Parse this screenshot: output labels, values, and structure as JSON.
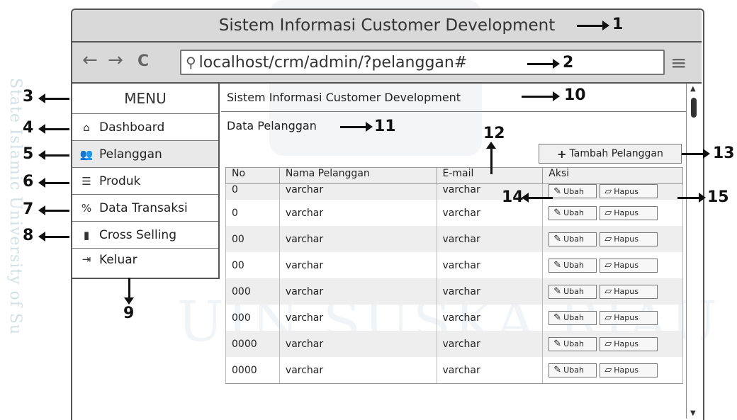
{
  "watermark": {
    "side": "State Islamic University of Su",
    "big": "UIN SUSKA RIAU"
  },
  "window": {
    "title": "Sistem Informasi Customer Development"
  },
  "browser": {
    "back": "←",
    "forward": "→",
    "reload": "C",
    "url": "localhost/crm/admin/?pelanggan#",
    "menu_icon": "≡"
  },
  "sidebar": {
    "title": "MENU",
    "items": [
      {
        "label": "Dashboard",
        "icon": "home-icon",
        "glyph": "⌂"
      },
      {
        "label": "Pelanggan",
        "icon": "users-icon",
        "glyph": "👥"
      },
      {
        "label": "Produk",
        "icon": "list-icon",
        "glyph": "☰"
      },
      {
        "label": "Data Transaksi",
        "icon": "percent-icon",
        "glyph": "%"
      },
      {
        "label": "Cross Selling",
        "icon": "file-icon",
        "glyph": "▮"
      },
      {
        "label": "Keluar",
        "icon": "logout-icon",
        "glyph": "⇥"
      }
    ]
  },
  "content": {
    "header": "Sistem Informasi Customer Development",
    "section_title": "Data Pelanggan",
    "add_button": "Tambah Pelanggan",
    "table": {
      "columns": [
        "No",
        "Nama Pelanggan",
        "E-mail",
        "Aksi"
      ],
      "rows": [
        {
          "no": "0",
          "nama": "varchar",
          "email": "varchar"
        },
        {
          "no": "0",
          "nama": "varchar",
          "email": "varchar"
        },
        {
          "no": "00",
          "nama": "varchar",
          "email": "varchar"
        },
        {
          "no": "00",
          "nama": "varchar",
          "email": "varchar"
        },
        {
          "no": "000",
          "nama": "varchar",
          "email": "varchar"
        },
        {
          "no": "000",
          "nama": "varchar",
          "email": "varchar"
        },
        {
          "no": "0000",
          "nama": "varchar",
          "email": "varchar"
        },
        {
          "no": "0000",
          "nama": "varchar",
          "email": "varchar"
        }
      ],
      "edit_label": "Ubah",
      "delete_label": "Hapus"
    }
  },
  "annotations": [
    "1",
    "2",
    "3",
    "4",
    "5",
    "6",
    "7",
    "8",
    "9",
    "10",
    "11",
    "12",
    "13",
    "14",
    "15"
  ]
}
